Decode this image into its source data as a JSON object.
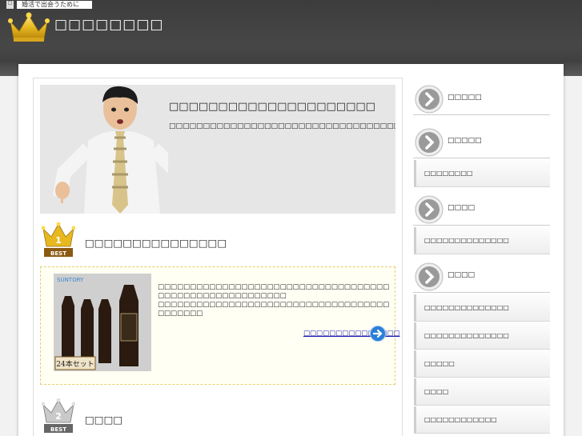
{
  "header": {
    "tagline": "婚活で出会うために",
    "tagline_marker": "□",
    "site_title": "□□□□□□□□"
  },
  "hero": {
    "heading": "□□□□□□□□□□□□□□□□□□□□□",
    "subtext": "□□□□□□□□□□□□□□□□□□□□□□□□□□□□□□□□□□□□□□□□□□□□□□□□"
  },
  "ranking": [
    {
      "rank": 1,
      "badge_number": "1",
      "badge_text": "BEST",
      "title": "□□□□□□□□□□□□□□□",
      "description_line1": "□□□□□□□□□□□□□□□□□□□□□□□□□□□□□□□□□□□□□□□□□□□□□□□□□□□□□□□□",
      "description_line2": "□□□□□□□□□□□□□□□□□□□□□□□□□□□□□□□□□□□□□□□□□□□",
      "link_text": "□□□□□□□□□□□□□□□",
      "product_brand": "SUNTORY",
      "product_tag": "24本セット"
    },
    {
      "rank": 2,
      "badge_number": "2",
      "badge_text": "BEST",
      "title": "□□□□"
    }
  ],
  "sidebar": [
    {
      "type": "head",
      "label": "□□□□□"
    },
    {
      "type": "head",
      "label": "□□□□□"
    },
    {
      "type": "item",
      "label": "□□□□□□□□"
    },
    {
      "type": "head",
      "label": "□□□□"
    },
    {
      "type": "item",
      "label": "□□□□□□□□□□□□□□"
    },
    {
      "type": "head",
      "label": "□□□□"
    },
    {
      "type": "item",
      "label": "□□□□□□□□□□□□□□"
    },
    {
      "type": "item",
      "label": "□□□□□□□□□□□□□□"
    },
    {
      "type": "item",
      "label": "□□□□□"
    },
    {
      "type": "item",
      "label": "□□□□"
    },
    {
      "type": "item",
      "label": "□□□□□□□□□□□□"
    }
  ],
  "colors": {
    "header_bg": "#444444",
    "crown_gold": "#e8b820",
    "link": "#1a1ab0",
    "accent_blue": "#2a7fd8"
  }
}
